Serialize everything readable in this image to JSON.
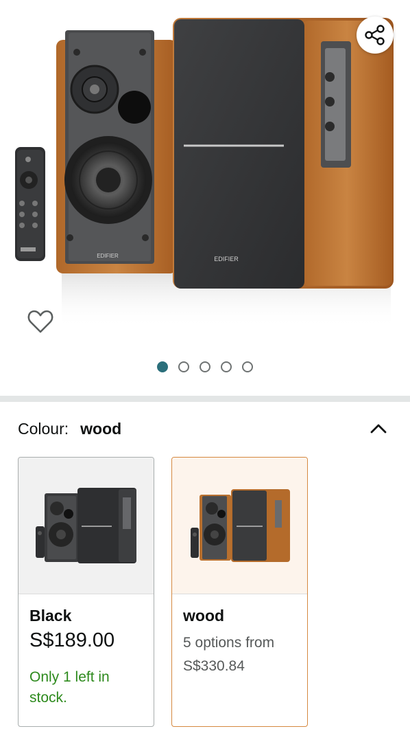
{
  "carousel": {
    "image_count": 5,
    "active_index": 0
  },
  "hero": {
    "product_brand_mark": "EDIFIER"
  },
  "colour": {
    "label": "Colour:",
    "selected": "wood"
  },
  "swatches": [
    {
      "name": "Black",
      "price": "S$189.00",
      "stock": "Only 1 left in stock.",
      "selected": false
    },
    {
      "name": "wood",
      "options_line1": "5 options from",
      "options_line2": "S$330.84",
      "selected": true
    }
  ],
  "icons": {
    "share": "share-icon",
    "wishlist": "heart-icon",
    "collapse": "chevron-up-icon"
  },
  "colors": {
    "accent_teal": "#2b6f7b",
    "selected_border": "#d5883f",
    "in_stock_green": "#2d8a1d"
  }
}
